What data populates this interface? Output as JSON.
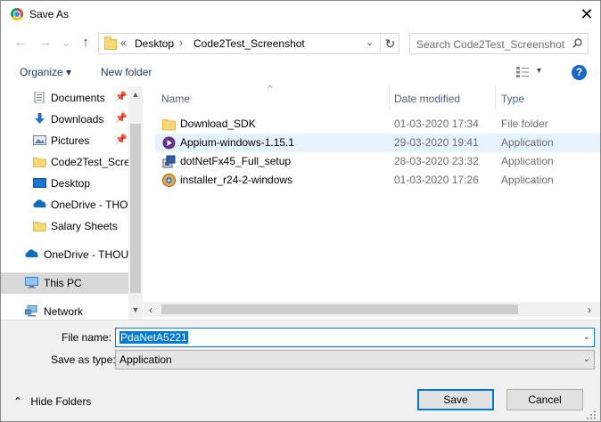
{
  "window": {
    "title": "Save As",
    "close_glyph": "✕"
  },
  "nav": {
    "back_glyph": "←",
    "forward_glyph": "→",
    "recent_glyph": "⌄",
    "up_glyph": "↑",
    "address": {
      "overflow": "«",
      "crumbs": [
        "Desktop",
        "Code2Test_Screenshot"
      ],
      "sep": "›",
      "drop_glyph": "⌄",
      "refresh_glyph": "↻"
    },
    "search": {
      "placeholder": "Search Code2Test_Screenshot"
    }
  },
  "toolbar": {
    "organize": "Organize ▾",
    "new_folder": "New folder",
    "view_drop": "▾",
    "help": "?"
  },
  "sidebar": {
    "items": [
      {
        "label": "Documents",
        "icon": "documents-icon",
        "pinned": true
      },
      {
        "label": "Downloads",
        "icon": "downloads-icon",
        "pinned": true
      },
      {
        "label": "Pictures",
        "icon": "pictures-icon",
        "pinned": true
      },
      {
        "label": "Code2Test_Scree",
        "icon": "folder-icon",
        "pinned": false
      },
      {
        "label": "Desktop",
        "icon": "desktop-icon",
        "pinned": false
      },
      {
        "label": "OneDrive - THO",
        "icon": "onedrive-icon",
        "pinned": false
      },
      {
        "label": "Salary Sheets",
        "icon": "folder-icon",
        "pinned": false
      },
      {
        "label": "OneDrive - THOU",
        "icon": "onedrive-icon",
        "pinned": false
      },
      {
        "label": "This PC",
        "icon": "this-pc-icon",
        "pinned": false,
        "selected": true
      },
      {
        "label": "Network",
        "icon": "network-icon",
        "pinned": false
      }
    ],
    "pin_glyph": "📌"
  },
  "list": {
    "columns": [
      "Name",
      "Date modified",
      "Type"
    ],
    "sort_glyph": "^",
    "rows": [
      {
        "name": "Download_SDK",
        "date": "01-03-2020 17:34",
        "type": "File folder",
        "icon": "folder-icon"
      },
      {
        "name": "Appium-windows-1.15.1",
        "date": "29-03-2020 19:41",
        "type": "Application",
        "icon": "appium-icon",
        "highlighted": true
      },
      {
        "name": "dotNetFx45_Full_setup",
        "date": "28-03-2020 23:32",
        "type": "Application",
        "icon": "installer-icon"
      },
      {
        "name": "installer_r24-2-windows",
        "date": "01-03-2020 17:26",
        "type": "Application",
        "icon": "android-installer-icon"
      }
    ]
  },
  "form": {
    "filename_label": "File name:",
    "filename_value": "PdaNetA5221",
    "savetype_label": "Save as type:",
    "savetype_value": "Application",
    "dropdown_glyph": "⌄"
  },
  "footer": {
    "hide_folders": "Hide Folders",
    "hide_glyph": "⌃",
    "save": "Save",
    "cancel": "Cancel"
  },
  "colors": {
    "accent": "#0078d7",
    "selected_row": "#e5f3ff",
    "nav_selected": "#d9d9d9",
    "folder": "#f8d775"
  }
}
